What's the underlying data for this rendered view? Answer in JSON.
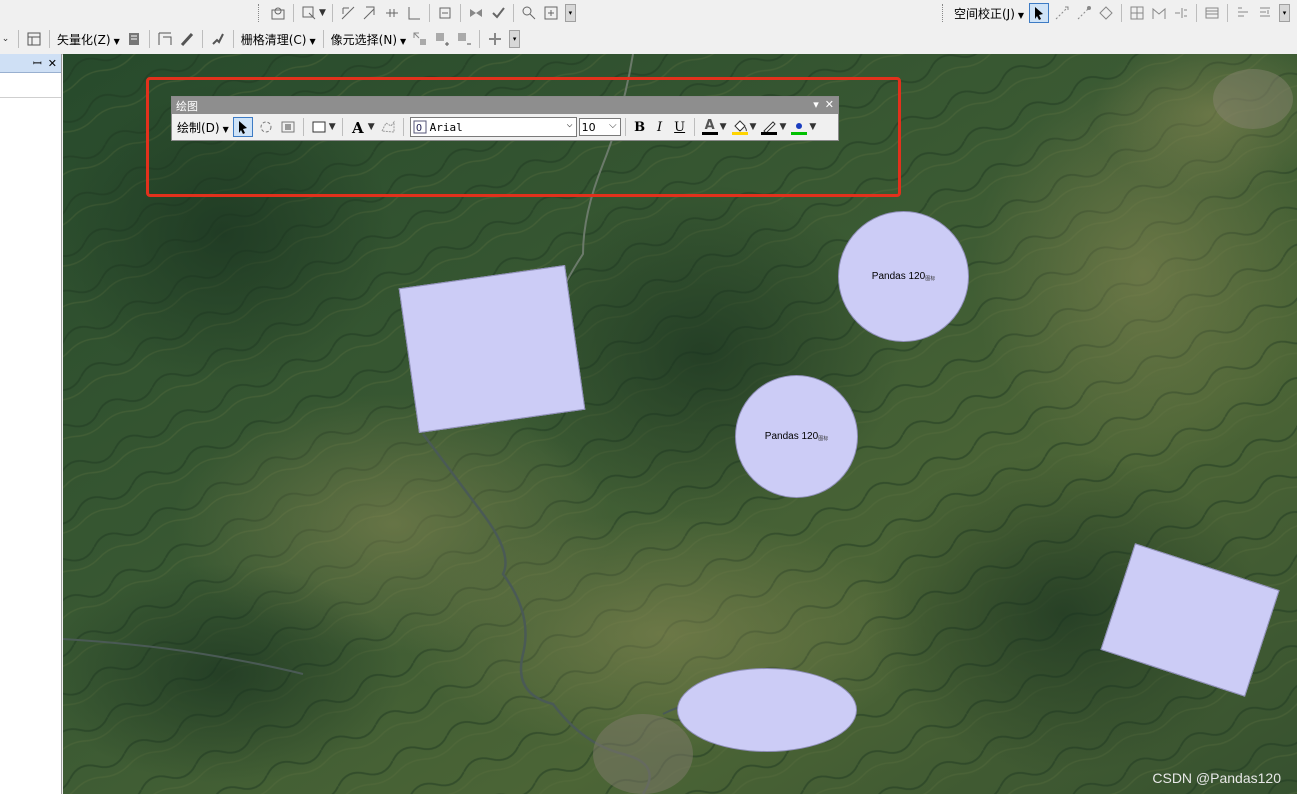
{
  "toolbar_top": {
    "spatial_adjust_label": "空间校正(J)",
    "vectorize_label": "矢量化(Z)",
    "raster_cleanup_label": "栅格清理(C)",
    "cell_select_label": "像元选择(N)"
  },
  "drawing_toolbar": {
    "title": "绘图",
    "drawing_menu_label": "绘制(D)",
    "font_name": "Arial",
    "font_size": "10",
    "bold_label": "B",
    "italic_label": "I",
    "underline_label": "U",
    "font_color_glyph": "A",
    "highlight_color": "#e2311c",
    "font_color": "#000000",
    "fill_color": "#ffd400",
    "line_color": "#000000",
    "marker_color": "#00c000"
  },
  "left_panel": {
    "pin_glyph": "ꟷ",
    "close_glyph": "✕"
  },
  "map": {
    "circle1_label": "Pandas 120",
    "circle1_sub": "图标",
    "circle2_label": "Pandas 120",
    "circle2_sub": "图标",
    "shape_fill_color": "#ccccf6",
    "watermark": "CSDN @Pandas120"
  }
}
